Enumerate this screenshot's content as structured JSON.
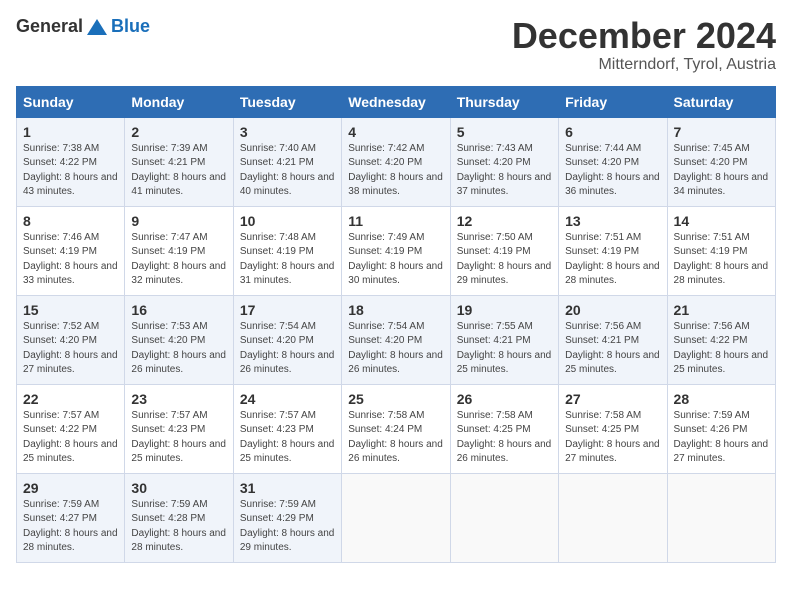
{
  "logo": {
    "general": "General",
    "blue": "Blue"
  },
  "title": {
    "month": "December 2024",
    "location": "Mitterndorf, Tyrol, Austria"
  },
  "days_of_week": [
    "Sunday",
    "Monday",
    "Tuesday",
    "Wednesday",
    "Thursday",
    "Friday",
    "Saturday"
  ],
  "weeks": [
    [
      {
        "day": "1",
        "sunrise": "7:38 AM",
        "sunset": "4:22 PM",
        "daylight": "8 hours and 43 minutes."
      },
      {
        "day": "2",
        "sunrise": "7:39 AM",
        "sunset": "4:21 PM",
        "daylight": "8 hours and 41 minutes."
      },
      {
        "day": "3",
        "sunrise": "7:40 AM",
        "sunset": "4:21 PM",
        "daylight": "8 hours and 40 minutes."
      },
      {
        "day": "4",
        "sunrise": "7:42 AM",
        "sunset": "4:20 PM",
        "daylight": "8 hours and 38 minutes."
      },
      {
        "day": "5",
        "sunrise": "7:43 AM",
        "sunset": "4:20 PM",
        "daylight": "8 hours and 37 minutes."
      },
      {
        "day": "6",
        "sunrise": "7:44 AM",
        "sunset": "4:20 PM",
        "daylight": "8 hours and 36 minutes."
      },
      {
        "day": "7",
        "sunrise": "7:45 AM",
        "sunset": "4:20 PM",
        "daylight": "8 hours and 34 minutes."
      }
    ],
    [
      {
        "day": "8",
        "sunrise": "7:46 AM",
        "sunset": "4:19 PM",
        "daylight": "8 hours and 33 minutes."
      },
      {
        "day": "9",
        "sunrise": "7:47 AM",
        "sunset": "4:19 PM",
        "daylight": "8 hours and 32 minutes."
      },
      {
        "day": "10",
        "sunrise": "7:48 AM",
        "sunset": "4:19 PM",
        "daylight": "8 hours and 31 minutes."
      },
      {
        "day": "11",
        "sunrise": "7:49 AM",
        "sunset": "4:19 PM",
        "daylight": "8 hours and 30 minutes."
      },
      {
        "day": "12",
        "sunrise": "7:50 AM",
        "sunset": "4:19 PM",
        "daylight": "8 hours and 29 minutes."
      },
      {
        "day": "13",
        "sunrise": "7:51 AM",
        "sunset": "4:19 PM",
        "daylight": "8 hours and 28 minutes."
      },
      {
        "day": "14",
        "sunrise": "7:51 AM",
        "sunset": "4:19 PM",
        "daylight": "8 hours and 28 minutes."
      }
    ],
    [
      {
        "day": "15",
        "sunrise": "7:52 AM",
        "sunset": "4:20 PM",
        "daylight": "8 hours and 27 minutes."
      },
      {
        "day": "16",
        "sunrise": "7:53 AM",
        "sunset": "4:20 PM",
        "daylight": "8 hours and 26 minutes."
      },
      {
        "day": "17",
        "sunrise": "7:54 AM",
        "sunset": "4:20 PM",
        "daylight": "8 hours and 26 minutes."
      },
      {
        "day": "18",
        "sunrise": "7:54 AM",
        "sunset": "4:20 PM",
        "daylight": "8 hours and 26 minutes."
      },
      {
        "day": "19",
        "sunrise": "7:55 AM",
        "sunset": "4:21 PM",
        "daylight": "8 hours and 25 minutes."
      },
      {
        "day": "20",
        "sunrise": "7:56 AM",
        "sunset": "4:21 PM",
        "daylight": "8 hours and 25 minutes."
      },
      {
        "day": "21",
        "sunrise": "7:56 AM",
        "sunset": "4:22 PM",
        "daylight": "8 hours and 25 minutes."
      }
    ],
    [
      {
        "day": "22",
        "sunrise": "7:57 AM",
        "sunset": "4:22 PM",
        "daylight": "8 hours and 25 minutes."
      },
      {
        "day": "23",
        "sunrise": "7:57 AM",
        "sunset": "4:23 PM",
        "daylight": "8 hours and 25 minutes."
      },
      {
        "day": "24",
        "sunrise": "7:57 AM",
        "sunset": "4:23 PM",
        "daylight": "8 hours and 25 minutes."
      },
      {
        "day": "25",
        "sunrise": "7:58 AM",
        "sunset": "4:24 PM",
        "daylight": "8 hours and 26 minutes."
      },
      {
        "day": "26",
        "sunrise": "7:58 AM",
        "sunset": "4:25 PM",
        "daylight": "8 hours and 26 minutes."
      },
      {
        "day": "27",
        "sunrise": "7:58 AM",
        "sunset": "4:25 PM",
        "daylight": "8 hours and 27 minutes."
      },
      {
        "day": "28",
        "sunrise": "7:59 AM",
        "sunset": "4:26 PM",
        "daylight": "8 hours and 27 minutes."
      }
    ],
    [
      {
        "day": "29",
        "sunrise": "7:59 AM",
        "sunset": "4:27 PM",
        "daylight": "8 hours and 28 minutes."
      },
      {
        "day": "30",
        "sunrise": "7:59 AM",
        "sunset": "4:28 PM",
        "daylight": "8 hours and 28 minutes."
      },
      {
        "day": "31",
        "sunrise": "7:59 AM",
        "sunset": "4:29 PM",
        "daylight": "8 hours and 29 minutes."
      },
      null,
      null,
      null,
      null
    ]
  ],
  "labels": {
    "sunrise": "Sunrise:",
    "sunset": "Sunset:",
    "daylight": "Daylight:"
  }
}
